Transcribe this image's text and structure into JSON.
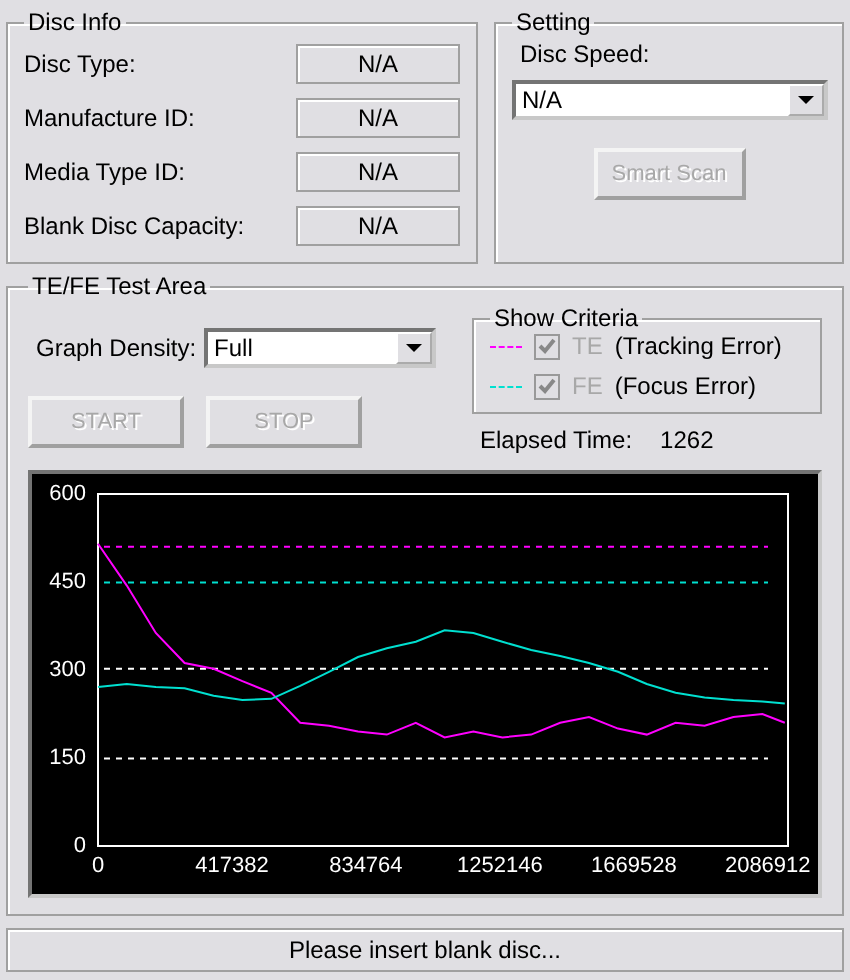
{
  "disc_info": {
    "title": "Disc Info",
    "fields": [
      {
        "label": "Disc Type:",
        "value": "N/A"
      },
      {
        "label": "Manufacture ID:",
        "value": "N/A"
      },
      {
        "label": "Media Type ID:",
        "value": "N/A"
      },
      {
        "label": "Blank Disc Capacity:",
        "value": "N/A"
      }
    ]
  },
  "setting": {
    "title": "Setting",
    "speed_label": "Disc Speed:",
    "speed_value": "N/A",
    "smart_scan": {
      "label": "Smart Scan",
      "disabled": true
    }
  },
  "test_area": {
    "title": "TE/FE Test Area",
    "density_label": "Graph Density:",
    "density_value": "Full",
    "buttons": [
      {
        "label": "START",
        "disabled": true
      },
      {
        "label": "STOP",
        "disabled": true
      }
    ],
    "criteria": {
      "title": "Show Criteria",
      "items": [
        {
          "description": "(Tracking Error)",
          "checked": true,
          "disabled": true,
          "color": "#ff00ff"
        },
        {
          "description": "(Focus Error)",
          "checked": true,
          "disabled": true,
          "color": "#00e0d0"
        }
      ]
    },
    "elapsed_label": "Elapsed Time:",
    "elapsed_value": "1262",
    "chart_data": {
      "type": "line",
      "x": [
        0,
        90000,
        180000,
        270000,
        360000,
        450000,
        540000,
        630000,
        720000,
        810000,
        900000,
        990000,
        1080000,
        1170000,
        1260000,
        1350000,
        1440000,
        1530000,
        1620000,
        1710000,
        1800000,
        1890000,
        1980000,
        2070000,
        2140000
      ],
      "series": [
        {
          "name": "TE",
          "color": "#ff00ff",
          "values": [
            515,
            444,
            363,
            312,
            302,
            281,
            261,
            210,
            205,
            195,
            190,
            210,
            185,
            195,
            185,
            190,
            210,
            220,
            200,
            190,
            210,
            205,
            220,
            225,
            210
          ]
        },
        {
          "name": "FE",
          "color": "#00e0d0",
          "values": [
            271,
            276,
            271,
            269,
            256,
            249,
            251,
            273,
            297,
            322,
            337,
            348,
            368,
            363,
            348,
            334,
            324,
            312,
            297,
            276,
            261,
            253,
            249,
            246,
            243
          ]
        }
      ],
      "xlim": [
        0,
        2150000
      ],
      "ylim": [
        0,
        600
      ],
      "xticks": [
        0,
        417382,
        834764,
        1252146,
        1669528,
        2086912
      ],
      "yticks": [
        0,
        150,
        300,
        450,
        600
      ],
      "ref_lines": [
        {
          "axis": "y",
          "value": 510,
          "color": "#ff00ff"
        },
        {
          "axis": "y",
          "value": 449,
          "color": "#00e0d0"
        },
        {
          "axis": "y",
          "value": 302,
          "color": "#ffffff"
        },
        {
          "axis": "y",
          "value": 149,
          "color": "#ffffff"
        }
      ]
    }
  },
  "status_bar": {
    "text": "Please insert blank disc..."
  }
}
